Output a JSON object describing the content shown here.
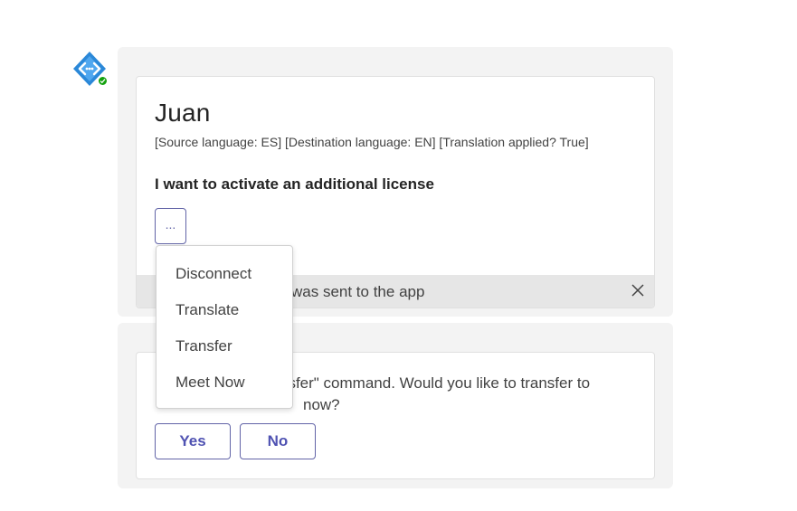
{
  "bot": {
    "icon": "code-brackets-icon",
    "presence": "available",
    "presence_color": "#13a10e",
    "accent_color": "#2b88d8"
  },
  "card1": {
    "name": "Juan",
    "meta": "[Source language: ES] [Destination language: EN] [Translation applied? True]",
    "message": "I want to activate an additional license",
    "more_label": "...",
    "notice": "was sent to the app"
  },
  "card2": {
    "text_visible_line1": "nsfer\" command. Would you like to transfer to",
    "text_visible_line2": "now?",
    "yes_label": "Yes",
    "no_label": "No"
  },
  "menu": {
    "items": [
      "Disconnect",
      "Translate",
      "Transfer",
      "Meet Now"
    ]
  },
  "colors": {
    "accent": "#6264a7",
    "bubble_bg": "#f3f3f3",
    "notice_bg": "#e6e6e6"
  }
}
